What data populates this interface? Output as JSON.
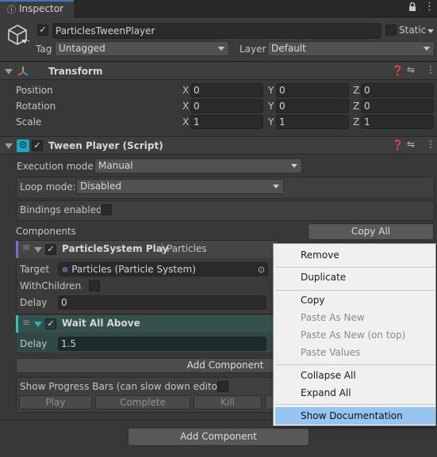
{
  "tab": {
    "label": "Inspector",
    "icon": "info-icon"
  },
  "window_controls": {
    "lock": "lock-icon",
    "menu": "kebab-menu-icon"
  },
  "gameobject": {
    "icon": "cube-icon",
    "active": true,
    "name": "ParticlesTweenPlayer",
    "static_label": "Static",
    "static": false,
    "tag_label": "Tag",
    "tag": "Untagged",
    "layer_label": "Layer",
    "layer": "Default"
  },
  "transform": {
    "title": "Transform",
    "icon": "transform-axes-icon",
    "rows": [
      {
        "label": "Position",
        "x": "0",
        "y": "0",
        "z": "0"
      },
      {
        "label": "Rotation",
        "x": "0",
        "y": "0",
        "z": "0"
      },
      {
        "label": "Scale",
        "x": "1",
        "y": "1",
        "z": "1"
      }
    ],
    "axes": {
      "x": "X",
      "y": "Y",
      "z": "Z"
    }
  },
  "tween_player": {
    "title": "Tween Player (Script)",
    "icon": "script-gear-icon",
    "enabled": true,
    "execution_mode_label": "Execution mode:",
    "execution_mode": "Manual",
    "loop_mode_label": "Loop mode:",
    "loop_mode": "Disabled",
    "bindings_label": "Bindings enabled",
    "bindings_enabled": false,
    "components_label": "Components",
    "copy_all": "Copy All",
    "components": [
      {
        "title": "ParticleSystem Play",
        "subtitle": "Particles",
        "accent": "#7c6ad8",
        "enabled": true,
        "target_label": "Target",
        "target_value": "Particles (Particle System)",
        "with_children_label": "WithChildren",
        "with_children": false,
        "delay_label": "Delay",
        "delay": "0"
      },
      {
        "title": "Wait All Above",
        "accent": "#2dc5c0",
        "enabled": true,
        "delay_label": "Delay",
        "delay": "1.5"
      }
    ],
    "add_component": "Add Component",
    "progress_label": "Show Progress Bars (can slow down editor)",
    "progress_enabled": false,
    "play": "Play",
    "complete": "Complete",
    "kill": "Kill"
  },
  "add_component": "Add Component",
  "context_menu": {
    "items": [
      {
        "label": "Remove",
        "enabled": true
      },
      {
        "label": "Duplicate",
        "enabled": true
      },
      {
        "label": "Copy",
        "enabled": true
      },
      {
        "label": "Paste As New",
        "enabled": false
      },
      {
        "label": "Paste As New (on top)",
        "enabled": false
      },
      {
        "label": "Paste Values",
        "enabled": false
      },
      {
        "label": "Collapse All",
        "enabled": true
      },
      {
        "label": "Expand All",
        "enabled": true
      },
      {
        "label": "Show Documentation",
        "enabled": true,
        "highlighted": true
      }
    ]
  },
  "colors": {
    "background": "#383838",
    "field": "#2a2a2a",
    "menu_bg": "#f0f0f0",
    "menu_highlight": "#96c6f0",
    "wait_accent": "#2dc5c0",
    "play_accent": "#7c6ad8"
  }
}
